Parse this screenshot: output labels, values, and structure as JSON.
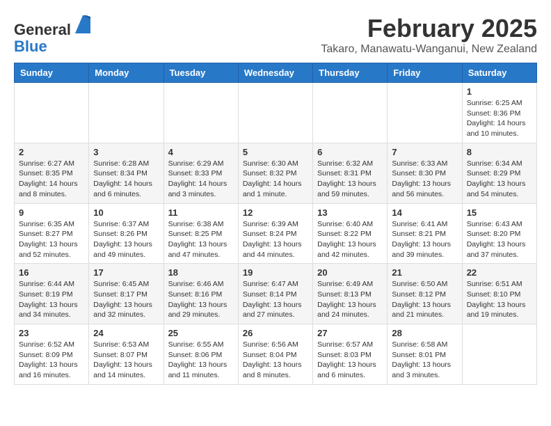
{
  "header": {
    "logo_general": "General",
    "logo_blue": "Blue",
    "month_title": "February 2025",
    "location": "Takaro, Manawatu-Wanganui, New Zealand"
  },
  "days_of_week": [
    "Sunday",
    "Monday",
    "Tuesday",
    "Wednesday",
    "Thursday",
    "Friday",
    "Saturday"
  ],
  "weeks": [
    [
      {
        "day": "",
        "info": ""
      },
      {
        "day": "",
        "info": ""
      },
      {
        "day": "",
        "info": ""
      },
      {
        "day": "",
        "info": ""
      },
      {
        "day": "",
        "info": ""
      },
      {
        "day": "",
        "info": ""
      },
      {
        "day": "1",
        "info": "Sunrise: 6:25 AM\nSunset: 8:36 PM\nDaylight: 14 hours and 10 minutes."
      }
    ],
    [
      {
        "day": "2",
        "info": "Sunrise: 6:27 AM\nSunset: 8:35 PM\nDaylight: 14 hours and 8 minutes."
      },
      {
        "day": "3",
        "info": "Sunrise: 6:28 AM\nSunset: 8:34 PM\nDaylight: 14 hours and 6 minutes."
      },
      {
        "day": "4",
        "info": "Sunrise: 6:29 AM\nSunset: 8:33 PM\nDaylight: 14 hours and 3 minutes."
      },
      {
        "day": "5",
        "info": "Sunrise: 6:30 AM\nSunset: 8:32 PM\nDaylight: 14 hours and 1 minute."
      },
      {
        "day": "6",
        "info": "Sunrise: 6:32 AM\nSunset: 8:31 PM\nDaylight: 13 hours and 59 minutes."
      },
      {
        "day": "7",
        "info": "Sunrise: 6:33 AM\nSunset: 8:30 PM\nDaylight: 13 hours and 56 minutes."
      },
      {
        "day": "8",
        "info": "Sunrise: 6:34 AM\nSunset: 8:29 PM\nDaylight: 13 hours and 54 minutes."
      }
    ],
    [
      {
        "day": "9",
        "info": "Sunrise: 6:35 AM\nSunset: 8:27 PM\nDaylight: 13 hours and 52 minutes."
      },
      {
        "day": "10",
        "info": "Sunrise: 6:37 AM\nSunset: 8:26 PM\nDaylight: 13 hours and 49 minutes."
      },
      {
        "day": "11",
        "info": "Sunrise: 6:38 AM\nSunset: 8:25 PM\nDaylight: 13 hours and 47 minutes."
      },
      {
        "day": "12",
        "info": "Sunrise: 6:39 AM\nSunset: 8:24 PM\nDaylight: 13 hours and 44 minutes."
      },
      {
        "day": "13",
        "info": "Sunrise: 6:40 AM\nSunset: 8:22 PM\nDaylight: 13 hours and 42 minutes."
      },
      {
        "day": "14",
        "info": "Sunrise: 6:41 AM\nSunset: 8:21 PM\nDaylight: 13 hours and 39 minutes."
      },
      {
        "day": "15",
        "info": "Sunrise: 6:43 AM\nSunset: 8:20 PM\nDaylight: 13 hours and 37 minutes."
      }
    ],
    [
      {
        "day": "16",
        "info": "Sunrise: 6:44 AM\nSunset: 8:19 PM\nDaylight: 13 hours and 34 minutes."
      },
      {
        "day": "17",
        "info": "Sunrise: 6:45 AM\nSunset: 8:17 PM\nDaylight: 13 hours and 32 minutes."
      },
      {
        "day": "18",
        "info": "Sunrise: 6:46 AM\nSunset: 8:16 PM\nDaylight: 13 hours and 29 minutes."
      },
      {
        "day": "19",
        "info": "Sunrise: 6:47 AM\nSunset: 8:14 PM\nDaylight: 13 hours and 27 minutes."
      },
      {
        "day": "20",
        "info": "Sunrise: 6:49 AM\nSunset: 8:13 PM\nDaylight: 13 hours and 24 minutes."
      },
      {
        "day": "21",
        "info": "Sunrise: 6:50 AM\nSunset: 8:12 PM\nDaylight: 13 hours and 21 minutes."
      },
      {
        "day": "22",
        "info": "Sunrise: 6:51 AM\nSunset: 8:10 PM\nDaylight: 13 hours and 19 minutes."
      }
    ],
    [
      {
        "day": "23",
        "info": "Sunrise: 6:52 AM\nSunset: 8:09 PM\nDaylight: 13 hours and 16 minutes."
      },
      {
        "day": "24",
        "info": "Sunrise: 6:53 AM\nSunset: 8:07 PM\nDaylight: 13 hours and 14 minutes."
      },
      {
        "day": "25",
        "info": "Sunrise: 6:55 AM\nSunset: 8:06 PM\nDaylight: 13 hours and 11 minutes."
      },
      {
        "day": "26",
        "info": "Sunrise: 6:56 AM\nSunset: 8:04 PM\nDaylight: 13 hours and 8 minutes."
      },
      {
        "day": "27",
        "info": "Sunrise: 6:57 AM\nSunset: 8:03 PM\nDaylight: 13 hours and 6 minutes."
      },
      {
        "day": "28",
        "info": "Sunrise: 6:58 AM\nSunset: 8:01 PM\nDaylight: 13 hours and 3 minutes."
      },
      {
        "day": "",
        "info": ""
      }
    ]
  ]
}
